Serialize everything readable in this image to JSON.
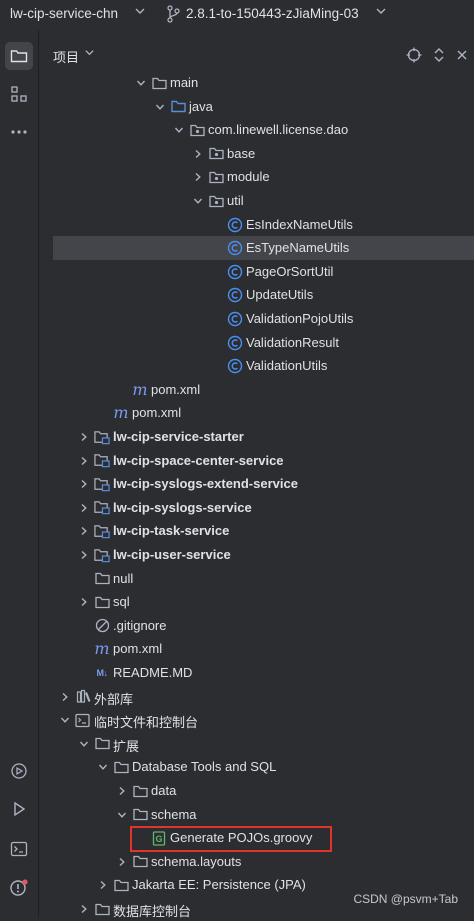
{
  "titlebar": {
    "project_name": "lw-cip-service-chn",
    "branch_name": "2.8.1-to-150443-zJiaMing-03"
  },
  "panel": {
    "title": "项目"
  },
  "tree": [
    {
      "label": "main",
      "level": 4,
      "kind": "folder",
      "arrow": "down"
    },
    {
      "label": "java",
      "level": 5,
      "kind": "src-folder",
      "arrow": "down"
    },
    {
      "label": "com.linewell.license.dao",
      "level": 6,
      "kind": "package",
      "arrow": "down"
    },
    {
      "label": "base",
      "level": 7,
      "kind": "package",
      "arrow": "right"
    },
    {
      "label": "module",
      "level": 7,
      "kind": "package",
      "arrow": "right"
    },
    {
      "label": "util",
      "level": 7,
      "kind": "package",
      "arrow": "down"
    },
    {
      "label": "EsIndexNameUtils",
      "level": 8,
      "kind": "class",
      "arrow": "none"
    },
    {
      "label": "EsTypeNameUtils",
      "level": 8,
      "kind": "class",
      "arrow": "none",
      "selected": true
    },
    {
      "label": "PageOrSortUtil",
      "level": 8,
      "kind": "class",
      "arrow": "none"
    },
    {
      "label": "UpdateUtils",
      "level": 8,
      "kind": "class",
      "arrow": "none"
    },
    {
      "label": "ValidationPojoUtils",
      "level": 8,
      "kind": "class",
      "arrow": "none"
    },
    {
      "label": "ValidationResult",
      "level": 8,
      "kind": "class",
      "arrow": "none"
    },
    {
      "label": "ValidationUtils",
      "level": 8,
      "kind": "class",
      "arrow": "none"
    },
    {
      "label": "pom.xml",
      "level": 3,
      "kind": "maven",
      "arrow": "none"
    },
    {
      "label": "pom.xml",
      "level": 2,
      "kind": "maven",
      "arrow": "none"
    },
    {
      "label": "lw-cip-service-starter",
      "level": 1,
      "kind": "module",
      "arrow": "right",
      "bold": true
    },
    {
      "label": "lw-cip-space-center-service",
      "level": 1,
      "kind": "module",
      "arrow": "right",
      "bold": true
    },
    {
      "label": "lw-cip-syslogs-extend-service",
      "level": 1,
      "kind": "module",
      "arrow": "right",
      "bold": true
    },
    {
      "label": "lw-cip-syslogs-service",
      "level": 1,
      "kind": "module",
      "arrow": "right",
      "bold": true
    },
    {
      "label": "lw-cip-task-service",
      "level": 1,
      "kind": "module",
      "arrow": "right",
      "bold": true
    },
    {
      "label": "lw-cip-user-service",
      "level": 1,
      "kind": "module",
      "arrow": "right",
      "bold": true
    },
    {
      "label": "null",
      "level": 1,
      "kind": "folder",
      "arrow": "none"
    },
    {
      "label": "sql",
      "level": 1,
      "kind": "folder",
      "arrow": "right"
    },
    {
      "label": ".gitignore",
      "level": 1,
      "kind": "ignore",
      "arrow": "none"
    },
    {
      "label": "pom.xml",
      "level": 1,
      "kind": "maven",
      "arrow": "none"
    },
    {
      "label": "README.MD",
      "level": 1,
      "kind": "markdown",
      "arrow": "none"
    },
    {
      "label": "外部库",
      "level": 0,
      "kind": "library",
      "arrow": "right"
    },
    {
      "label": "临时文件和控制台",
      "level": 0,
      "kind": "scratch",
      "arrow": "down"
    },
    {
      "label": "扩展",
      "level": 1,
      "kind": "folder",
      "arrow": "down"
    },
    {
      "label": "Database Tools and SQL",
      "level": 2,
      "kind": "folder",
      "arrow": "down"
    },
    {
      "label": "data",
      "level": 3,
      "kind": "folder",
      "arrow": "right"
    },
    {
      "label": "schema",
      "level": 3,
      "kind": "folder",
      "arrow": "down"
    },
    {
      "label": "Generate POJOs.groovy",
      "level": 4,
      "kind": "groovy",
      "arrow": "none"
    },
    {
      "label": "schema.layouts",
      "level": 3,
      "kind": "folder",
      "arrow": "right"
    },
    {
      "label": "Jakarta EE: Persistence (JPA)",
      "level": 2,
      "kind": "folder",
      "arrow": "right"
    },
    {
      "label": "数据库控制台",
      "level": 1,
      "kind": "folder",
      "arrow": "right"
    }
  ],
  "watermark": "CSDN @psvm+Tab",
  "colors": {
    "background": "#2b2d30",
    "selection": "#43454a",
    "class_icon": "#4a8ff0",
    "maven_icon": "#7b9bf0",
    "groovy_icon": "#5fb865",
    "highlight_border": "#e0352d"
  }
}
